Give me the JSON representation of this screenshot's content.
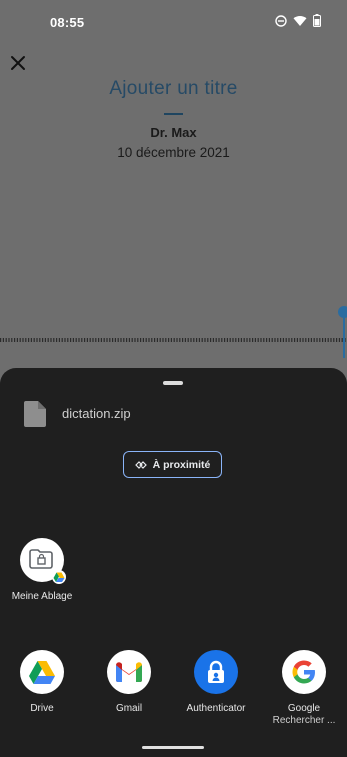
{
  "status_bar": {
    "time": "08:55"
  },
  "document": {
    "title": "Ajouter un titre",
    "author": "Dr. Max",
    "date": "10 décembre 2021"
  },
  "share_sheet": {
    "file_name": "dictation.zip",
    "nearby_label": "À proximité",
    "shortcut": {
      "label": "Meine Ablage"
    },
    "apps": [
      {
        "label": "Drive",
        "sublabel": ""
      },
      {
        "label": "Gmail",
        "sublabel": ""
      },
      {
        "label": "Authenticator",
        "sublabel": ""
      },
      {
        "label": "Google",
        "sublabel": "Rechercher ..."
      }
    ]
  },
  "colors": {
    "scrim_bg": "#6e6e6e",
    "sheet_bg": "#1f1f1f",
    "accent_blue": "#8ab4f8",
    "title_blue": "#264a66",
    "authenticator_blue": "#1a73e8"
  },
  "icons": [
    "close-icon",
    "do-not-disturb-icon",
    "wifi-icon",
    "battery-icon",
    "file-icon",
    "nearby-share-icon",
    "drive-folder-icon",
    "drive-icon",
    "gmail-icon",
    "authenticator-icon",
    "google-icon"
  ]
}
